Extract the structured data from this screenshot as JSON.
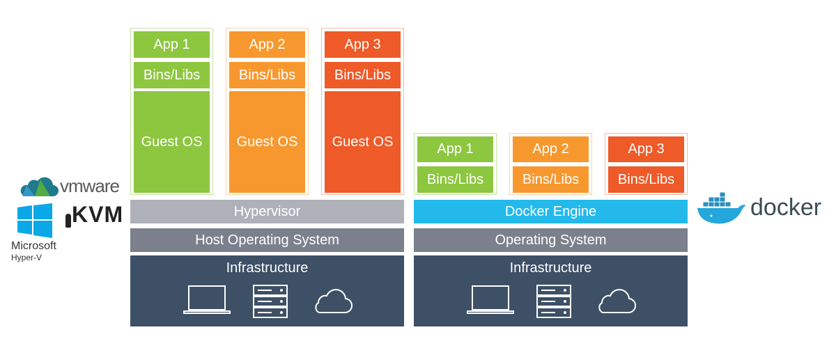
{
  "vm_side": {
    "apps": [
      {
        "app": "App 1",
        "libs": "Bins/Libs",
        "os": "Guest OS"
      },
      {
        "app": "App 2",
        "libs": "Bins/Libs",
        "os": "Guest OS"
      },
      {
        "app": "App 3",
        "libs": "Bins/Libs",
        "os": "Guest OS"
      }
    ],
    "hypervisor": "Hypervisor",
    "host_os": "Host Operating System",
    "infrastructure": "Infrastructure"
  },
  "docker_side": {
    "apps": [
      {
        "app": "App 1",
        "libs": "Bins/Libs"
      },
      {
        "app": "App 2",
        "libs": "Bins/Libs"
      },
      {
        "app": "App 3",
        "libs": "Bins/Libs"
      }
    ],
    "engine": "Docker Engine",
    "os": "Operating System",
    "infrastructure": "Infrastructure"
  },
  "logos": {
    "vmware": "vmware",
    "kvm": "KVM",
    "microsoft": "Microsoft",
    "hyperv": "Hyper-V",
    "docker": "docker"
  },
  "colors": {
    "app1": "#8dc63f",
    "app2": "#f7982f",
    "app3": "#ee5a28",
    "hypervisor": "#aeb1b8",
    "os": "#7b808c",
    "infra": "#3e5066",
    "docker": "#23b9eb"
  }
}
